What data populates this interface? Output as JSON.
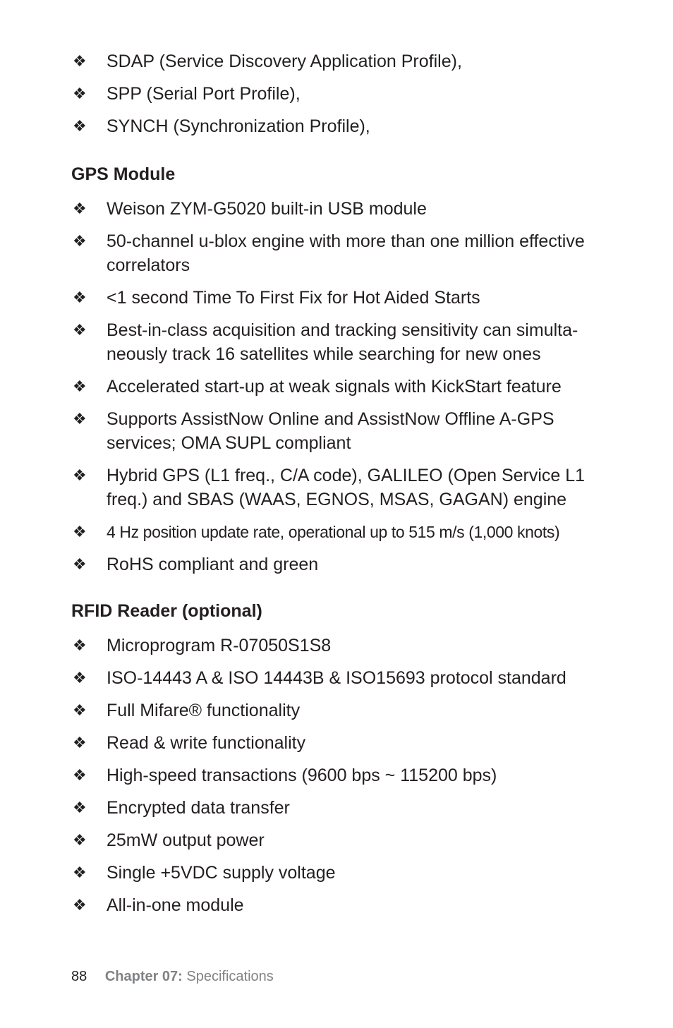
{
  "bullet_glyph": "❖",
  "bluetooth_profiles": [
    "SDAP (Service Discovery Application Profile),",
    "SPP (Serial Port Profile),",
    "SYNCH (Synchronization Profile),"
  ],
  "gps": {
    "heading": "GPS  Module",
    "items": [
      "Weison ZYM-G5020 built-in USB module",
      "50-channel u-blox engine with more than one million effective correlators",
      "<1 second Time To First Fix for Hot Aided Starts",
      "Best-in-class acquisition and tracking sensitivity can simulta-neously track 16 satellites while searching for new ones",
      "Accelerated start-up at weak signals with KickStart feature",
      "Supports AssistNow Online and AssistNow Offline A-GPS services; OMA SUPL compliant",
      "Hybrid GPS (L1 freq., C/A code), GALILEO (Open Service L1 freq.) and SBAS (WAAS, EGNOS, MSAS, GAGAN) engine",
      "4 Hz position update rate, operational up to 515 m/s (1,000 knots)",
      "RoHS compliant and green"
    ]
  },
  "rfid": {
    "heading": "RFID Reader (optional)",
    "items": [
      "Microprogram R-07050S1S8",
      "ISO-14443 A & ISO 14443B & ISO15693 protocol standard",
      "Full Mifare® functionality",
      "Read & write functionality",
      "High-speed transactions (9600 bps ~ 115200 bps)",
      "Encrypted data transfer",
      "25mW output power",
      "Single +5VDC supply voltage",
      "All-in-one module"
    ]
  },
  "footer": {
    "page_number": "88",
    "chapter": "Chapter 07:",
    "section": "Specifications"
  }
}
